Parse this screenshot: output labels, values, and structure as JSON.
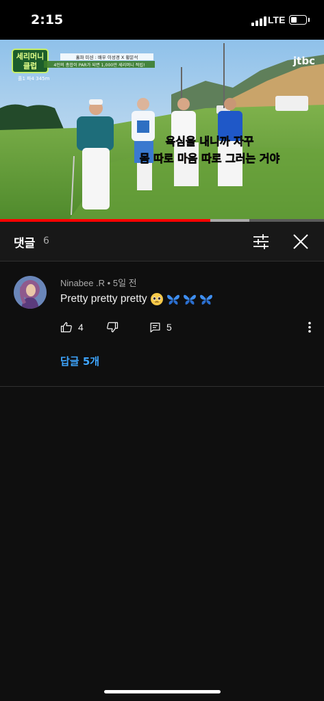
{
  "status_bar": {
    "time": "2:15",
    "network": "LTE",
    "battery_level": 0.4
  },
  "video": {
    "show_logo": "세리머니 클럽",
    "hole_info": "홀1 파4 345m",
    "mission_line1": "홀파 미션 : 배우 이성경 X 황문석",
    "mission_line2": "4인의 총합이 PAR가 되면 1,000만 세리머니 적립!",
    "broadcaster": "jtbc",
    "subtitle_line1": "욕심을 내니까 자꾸",
    "subtitle_line2_part1": "몸 따로 마음 따로",
    "subtitle_line2_part2": " 그러는 거야",
    "progress": 0.65,
    "buffered": 0.77,
    "colors": {
      "progress": "#ff0000",
      "subtitle_highlight": "#ff6a3d"
    }
  },
  "comments_panel": {
    "title": "댓글",
    "count": "6",
    "filter_icon": "sliders-icon",
    "close_icon": "close-icon"
  },
  "comment": {
    "author": "Ninabee .R",
    "separator": "•",
    "age": "5일 전",
    "text": "Pretty pretty pretty",
    "emojis": [
      "pleading-face",
      "blue-butterfly",
      "blue-butterfly",
      "blue-butterfly"
    ],
    "likes": "4",
    "replies_count": "5",
    "replies_link": "답글 5개",
    "colors": {
      "link": "#3ea6ff"
    }
  }
}
